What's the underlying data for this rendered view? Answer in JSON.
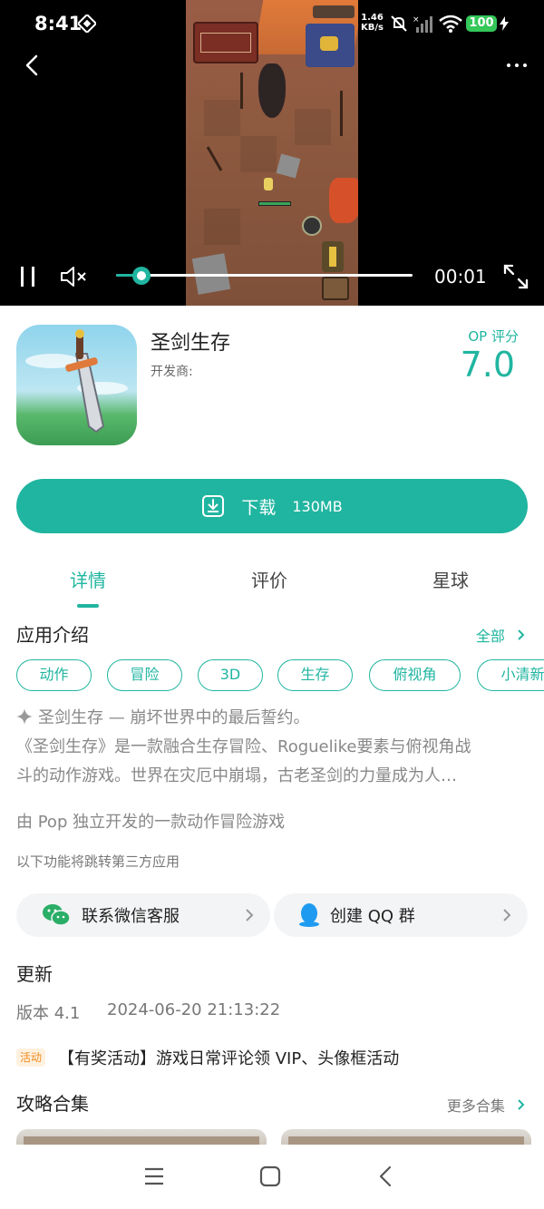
{
  "status_bar": {
    "time": "8:41",
    "net_speed_value": "1.46",
    "net_speed_unit": "KB/s",
    "battery": "100"
  },
  "video": {
    "elapsed": "00:01",
    "progress": 0.09
  },
  "app": {
    "name": "圣剑生存",
    "developer_label": "开发商:",
    "score_label": "OP 评分",
    "score": "7.0"
  },
  "download": {
    "label": "下载",
    "size": "130MB"
  },
  "tabs": [
    {
      "label": "详情",
      "active": true
    },
    {
      "label": "评价",
      "active": false
    },
    {
      "label": "星球",
      "active": false
    }
  ],
  "intro": {
    "title": "应用介绍",
    "all_label": "全部",
    "tags": [
      "动作",
      "冒险",
      "3D",
      "生存",
      "俯视角",
      "小清新"
    ],
    "line1": "圣剑生存 — 崩坏世界中的最后誓约。",
    "line2": "《圣剑生存》是一款融合生存冒险、Roguelike要素与俯视角战",
    "line3": "斗的动作游戏。世界在灾厄中崩塌，古老圣剑的力量成为人…",
    "line4": "由 Pop 独立开发的一款动作冒险游戏",
    "third_party_note": "以下功能将跳转第三方应用"
  },
  "contacts": {
    "wechat_label": "联系微信客服",
    "qq_label": "创建 QQ 群"
  },
  "update": {
    "title": "更新",
    "version": "版本 4.1",
    "date": "2024-06-20 21:13:22",
    "badge": "活动",
    "activity_text": "【有奖活动】游戏日常评论领 VIP、头像框活动"
  },
  "guides": {
    "title": "攻略合集",
    "more_label": "更多合集"
  },
  "colors": {
    "accent": "#20b5a0",
    "badge_orange": "#f08a1e",
    "battery_green": "#34c759"
  }
}
